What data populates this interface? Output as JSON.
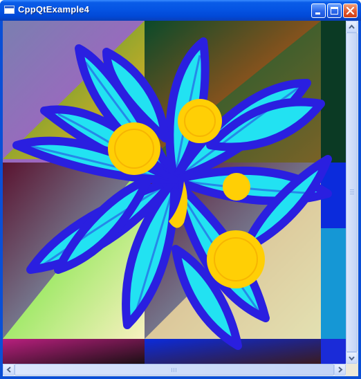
{
  "window": {
    "title": "CppQtExample4",
    "controls": [
      "minimize",
      "maximize",
      "close"
    ]
  },
  "icons": {
    "app": "app-window-icon",
    "minimize": "minimize-icon",
    "maximize": "maximize-icon",
    "close": "close-icon",
    "scroll_up": "arrow-up-icon",
    "scroll_down": "arrow-down-icon",
    "scroll_left": "arrow-left-icon",
    "scroll_right": "arrow-right-icon"
  },
  "canvas": {
    "description_colors": {
      "petal_fill": "#22e2f2",
      "petal_outline": "#2a1fe0",
      "flower_center": "#ffcf05"
    }
  },
  "colors": {
    "titlebar": "#0554e3",
    "close_button": "#e2582e",
    "frame": "#0a4fd6"
  }
}
